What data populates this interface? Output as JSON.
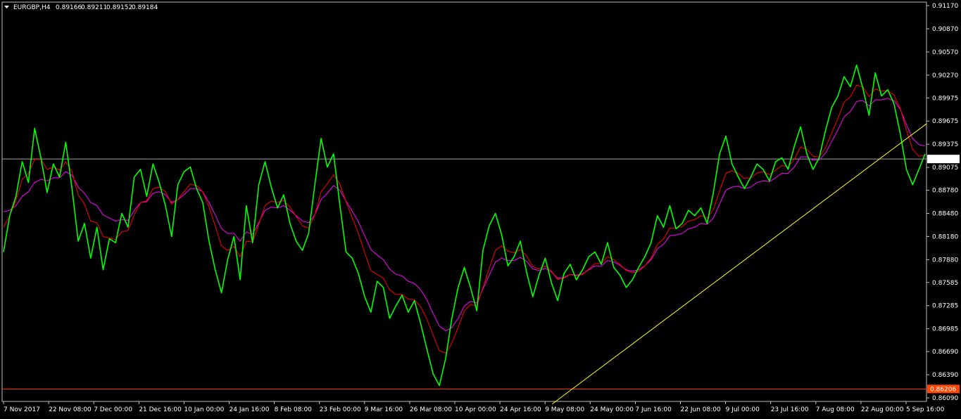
{
  "header": {
    "dropdown_icon": "triangle-down-icon",
    "symbol": "EURGBP,H4",
    "open": "0.89166",
    "high": "0.89211",
    "low": "0.89152",
    "close": "0.89184"
  },
  "colors": {
    "background": "#000000",
    "frame": "#c0c0c0",
    "price": "#00ff00",
    "ma_fast": "#ff0000",
    "ma_slow": "#ff00ff",
    "trendline": "#ffff00",
    "bid_line": "#a0a0a0",
    "support_line": "#ff4500",
    "support_label_bg": "#ff4500",
    "bid_label_bg": "#ffffff"
  },
  "chart_data": {
    "type": "line",
    "title": "EURGBP,H4",
    "ylim": [
      0.8609,
      0.9117
    ],
    "y_ticks": [
      "0.91170",
      "0.90870",
      "0.90570",
      "0.90270",
      "0.89975",
      "0.89675",
      "0.89375",
      "0.89075",
      "0.88780",
      "0.88480",
      "0.88180",
      "0.87880",
      "0.87585",
      "0.87285",
      "0.86985",
      "0.86690",
      "0.86390",
      "0.86090"
    ],
    "x_ticks": [
      "7 Nov 2017",
      "22 Nov 08:00",
      "7 Dec 00:00",
      "21 Dec 16:00",
      "10 Jan 00:00",
      "24 Jan 16:00",
      "8 Feb 08:00",
      "23 Feb 00:00",
      "9 Mar 16:00",
      "26 Mar 08:00",
      "10 Apr 00:00",
      "24 Apr 16:00",
      "9 May 08:00",
      "24 May 00:00",
      "7 Jun 16:00",
      "22 Jun 08:00",
      "9 Jul 00:00",
      "23 Jul 16:00",
      "7 Aug 08:00",
      "22 Aug 00:00",
      "5 Sep 16:00"
    ],
    "x_range": [
      "7 Nov 2017",
      "5 Sep 16:00"
    ],
    "horizontal_lines": [
      {
        "name": "bid",
        "value": 0.89184,
        "label": "0.89184"
      },
      {
        "name": "support",
        "value": 0.86206,
        "label": "0.86206"
      }
    ],
    "trendline": {
      "start": [
        "9 May 08:00",
        0.8601
      ],
      "end": [
        "5 Sep 16:00",
        0.8964
      ]
    },
    "series": [
      {
        "name": "",
        "role": "price",
        "values": [
          0.8798,
          0.8845,
          0.887,
          0.8915,
          0.8888,
          0.8958,
          0.892,
          0.8875,
          0.8912,
          0.8895,
          0.894,
          0.888,
          0.8812,
          0.8835,
          0.879,
          0.883,
          0.8775,
          0.8815,
          0.881,
          0.8848,
          0.883,
          0.8895,
          0.8905,
          0.887,
          0.8912,
          0.8888,
          0.8858,
          0.8818,
          0.8885,
          0.8902,
          0.8908,
          0.888,
          0.8862,
          0.8812,
          0.8775,
          0.8745,
          0.8788,
          0.8818,
          0.8762,
          0.8858,
          0.881,
          0.8885,
          0.8915,
          0.8882,
          0.8855,
          0.8872,
          0.8835,
          0.8812,
          0.88,
          0.8822,
          0.8885,
          0.8945,
          0.8908,
          0.8925,
          0.886,
          0.8798,
          0.879,
          0.877,
          0.874,
          0.872,
          0.876,
          0.8752,
          0.8712,
          0.8728,
          0.8742,
          0.872,
          0.8735,
          0.8705,
          0.8672,
          0.864,
          0.8625,
          0.866,
          0.8712,
          0.8752,
          0.8778,
          0.8752,
          0.8722,
          0.88,
          0.8832,
          0.8848,
          0.882,
          0.878,
          0.8792,
          0.8812,
          0.8772,
          0.874,
          0.8768,
          0.879,
          0.8758,
          0.8735,
          0.877,
          0.8782,
          0.8762,
          0.8775,
          0.8792,
          0.8798,
          0.8782,
          0.881,
          0.8778,
          0.8768,
          0.8752,
          0.8762,
          0.8778,
          0.8792,
          0.881,
          0.8845,
          0.883,
          0.8858,
          0.8828,
          0.8835,
          0.8852,
          0.8845,
          0.8855,
          0.8835,
          0.8875,
          0.8925,
          0.8948,
          0.8912,
          0.8895,
          0.888,
          0.8895,
          0.8912,
          0.8905,
          0.889,
          0.8915,
          0.892,
          0.8905,
          0.8935,
          0.896,
          0.8925,
          0.8905,
          0.892,
          0.8955,
          0.8985,
          0.9,
          0.9025,
          0.9012,
          0.904,
          0.901,
          0.8975,
          0.903,
          0.9,
          0.9008,
          0.899,
          0.8952,
          0.8905,
          0.8885,
          0.8905,
          0.8925
        ]
      },
      {
        "name": "",
        "role": "moving-average-fast",
        "values": [
          0.883,
          0.8845,
          0.8865,
          0.8892,
          0.89,
          0.8918,
          0.8918,
          0.8905,
          0.8908,
          0.8904,
          0.8915,
          0.8902,
          0.8872,
          0.886,
          0.8838,
          0.8836,
          0.8818,
          0.8816,
          0.8814,
          0.8824,
          0.8826,
          0.8846,
          0.8862,
          0.8864,
          0.888,
          0.8882,
          0.8876,
          0.886,
          0.8866,
          0.8876,
          0.8886,
          0.8884,
          0.8876,
          0.8856,
          0.8832,
          0.8806,
          0.88,
          0.8805,
          0.8792,
          0.8812,
          0.8811,
          0.8834,
          0.8858,
          0.8864,
          0.8862,
          0.8865,
          0.8856,
          0.8844,
          0.8832,
          0.8829,
          0.8846,
          0.8876,
          0.8886,
          0.8898,
          0.8886,
          0.8863,
          0.8842,
          0.8822,
          0.8797,
          0.8774,
          0.8769,
          0.8764,
          0.8749,
          0.8743,
          0.8743,
          0.8737,
          0.8736,
          0.8727,
          0.8711,
          0.869,
          0.867,
          0.8667,
          0.868,
          0.87,
          0.8722,
          0.873,
          0.8728,
          0.8752,
          0.8777,
          0.88,
          0.8806,
          0.8799,
          0.8797,
          0.8801,
          0.8793,
          0.8779,
          0.8776,
          0.878,
          0.8773,
          0.8762,
          0.8764,
          0.8769,
          0.8767,
          0.8769,
          0.8776,
          0.8783,
          0.8783,
          0.8792,
          0.8788,
          0.8782,
          0.8774,
          0.8771,
          0.8773,
          0.878,
          0.879,
          0.8808,
          0.8815,
          0.8829,
          0.8829,
          0.8831,
          0.8838,
          0.884,
          0.8845,
          0.8842,
          0.8853,
          0.8877,
          0.89,
          0.8903,
          0.89,
          0.8893,
          0.8894,
          0.89,
          0.8902,
          0.8898,
          0.8904,
          0.891,
          0.8908,
          0.8918,
          0.8934,
          0.8931,
          0.8922,
          0.8921,
          0.8933,
          0.8952,
          0.8971,
          0.8992,
          0.8999,
          0.9014,
          0.9012,
          0.8999,
          0.9009,
          0.9006,
          0.9007,
          0.9001,
          0.8984,
          0.8956,
          0.8931,
          0.8922,
          0.8923
        ]
      },
      {
        "name": "",
        "role": "moving-average-slow",
        "values": [
          0.885,
          0.8852,
          0.8858,
          0.887,
          0.8876,
          0.8888,
          0.8892,
          0.889,
          0.8894,
          0.8894,
          0.8902,
          0.8897,
          0.8882,
          0.8874,
          0.8862,
          0.8858,
          0.8846,
          0.8842,
          0.8838,
          0.884,
          0.8839,
          0.8852,
          0.8862,
          0.8863,
          0.8874,
          0.8876,
          0.8872,
          0.8862,
          0.8866,
          0.8872,
          0.888,
          0.888,
          0.8876,
          0.8862,
          0.8846,
          0.8828,
          0.8822,
          0.8822,
          0.8812,
          0.8824,
          0.8821,
          0.8836,
          0.8852,
          0.8856,
          0.8855,
          0.8858,
          0.8852,
          0.8845,
          0.8838,
          0.8836,
          0.8846,
          0.8866,
          0.8874,
          0.8884,
          0.8878,
          0.8864,
          0.8851,
          0.8837,
          0.8819,
          0.8801,
          0.8794,
          0.8788,
          0.8776,
          0.8769,
          0.8767,
          0.876,
          0.8757,
          0.8749,
          0.8736,
          0.8718,
          0.8702,
          0.8696,
          0.87,
          0.8712,
          0.8728,
          0.8734,
          0.8732,
          0.875,
          0.8768,
          0.8785,
          0.879,
          0.8787,
          0.8787,
          0.8791,
          0.8786,
          0.8776,
          0.8774,
          0.8777,
          0.8772,
          0.8764,
          0.8765,
          0.8769,
          0.8768,
          0.877,
          0.8775,
          0.878,
          0.878,
          0.8787,
          0.8785,
          0.8781,
          0.8775,
          0.8773,
          0.8775,
          0.878,
          0.8788,
          0.8802,
          0.8808,
          0.8819,
          0.882,
          0.8822,
          0.8828,
          0.883,
          0.8835,
          0.8834,
          0.8842,
          0.886,
          0.8878,
          0.8882,
          0.8883,
          0.888,
          0.8882,
          0.8888,
          0.889,
          0.8889,
          0.8894,
          0.89,
          0.89,
          0.8908,
          0.8921,
          0.8921,
          0.8917,
          0.8917,
          0.8926,
          0.8941,
          0.8956,
          0.8973,
          0.898,
          0.8993,
          0.8994,
          0.8987,
          0.8995,
          0.8995,
          0.8997,
          0.8994,
          0.8983,
          0.8963,
          0.8945,
          0.8937,
          0.8935
        ]
      }
    ]
  }
}
